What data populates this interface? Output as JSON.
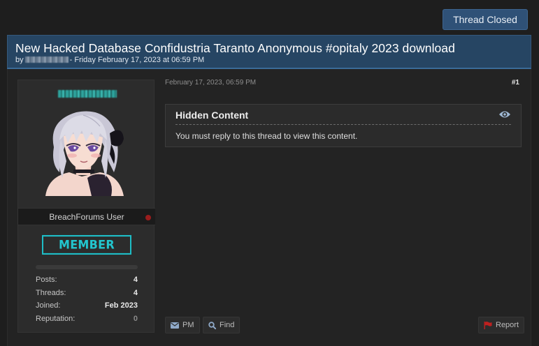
{
  "toolbar": {
    "thread_closed_label": "Thread Closed"
  },
  "thread": {
    "title": "New Hacked Database Confidustria Taranto Anonymous #opitaly 2023 download",
    "by_label": "by",
    "date_text": "- Friday February 17, 2023 at 06:59 PM"
  },
  "post": {
    "date": "February 17, 2023, 06:59 PM",
    "number": "#1",
    "hidden_content": {
      "title": "Hidden Content",
      "message": "You must reply to this thread to view this content."
    },
    "actions": {
      "pm": "PM",
      "find": "Find",
      "report": "Report"
    }
  },
  "user": {
    "usergroup": "BreachForums User",
    "badge": "MEMBER",
    "stats": [
      {
        "label": "Posts:",
        "value": "4"
      },
      {
        "label": "Threads:",
        "value": "4"
      },
      {
        "label": "Joined:",
        "value": "Feb 2023"
      },
      {
        "label": "Reputation:",
        "value": "0"
      }
    ]
  },
  "colors": {
    "header_bg": "#264563",
    "badge": "#1ebdc6",
    "offline": "#9a1d1d",
    "report_flag": "#c0201f"
  },
  "icons": [
    "eye-icon",
    "envelope-icon",
    "search-icon",
    "flag-icon"
  ]
}
